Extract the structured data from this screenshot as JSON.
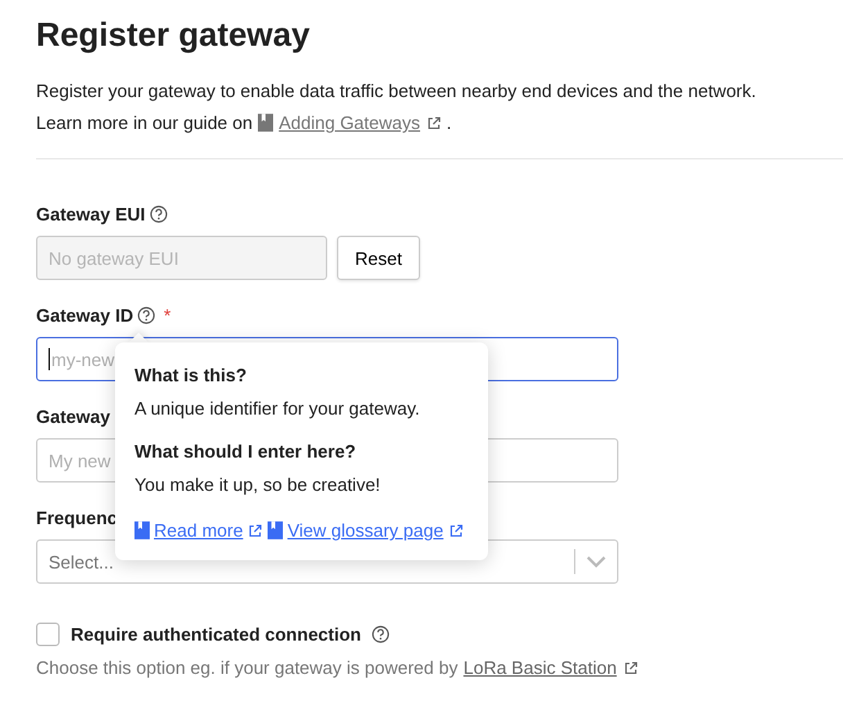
{
  "title": "Register gateway",
  "description": {
    "line_1": "Register your gateway to enable data traffic between nearby end devices and the network.",
    "line_2": "Learn more in our guide on",
    "link": "Adding Gateways",
    "end": "."
  },
  "fields": [
    {
      "kind": "eui",
      "label": "Gateway EUI",
      "help": true,
      "placeholder": "No gateway EUI",
      "button": "Reset",
      "focused": false
    },
    {
      "kind": "text",
      "label": "Gateway ID",
      "help": true,
      "required_mark": "*",
      "placeholder": "my-new",
      "focused": true
    },
    {
      "kind": "text",
      "label": "Gateway",
      "placeholder": "My new",
      "focused": false
    },
    {
      "kind": "select",
      "label": "Frequenc",
      "placeholder": "Select...",
      "focused": false
    }
  ],
  "checkbox": {
    "label": "Require authenticated connection",
    "checked": false,
    "hint": "Choose this option eg. if your gateway is powered by",
    "hint_link": "LoRa Basic Station"
  },
  "tooltip": {
    "heading_1": "What is this?",
    "text_1": "A unique identifier for your gateway.",
    "heading_2": "What should I enter here?",
    "text_2": "You make it up, so be creative!",
    "links": [
      "Read more",
      "View glossary page"
    ]
  }
}
